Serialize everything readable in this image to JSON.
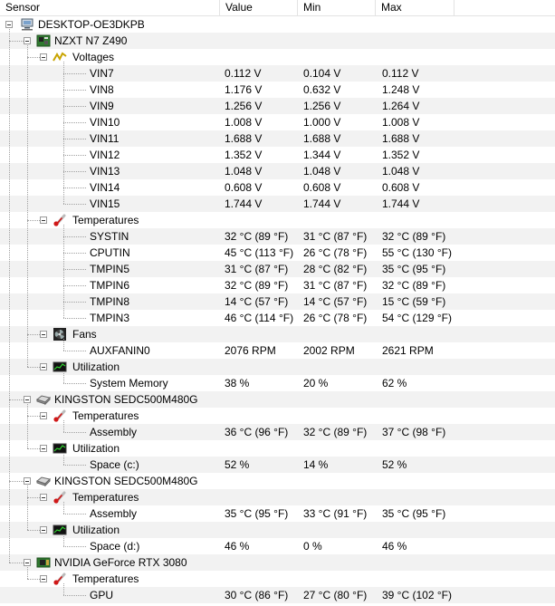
{
  "columns": {
    "sensor": "Sensor",
    "value": "Value",
    "min": "Min",
    "max": "Max"
  },
  "rows": [
    {
      "level": 0,
      "kind": "node",
      "icon": "computer-icon",
      "label": "DESKTOP-OE3DKPB"
    },
    {
      "level": 1,
      "kind": "node",
      "icon": "motherboard-icon",
      "label": "NZXT N7 Z490"
    },
    {
      "level": 2,
      "kind": "node",
      "icon": "voltage-icon",
      "label": "Voltages"
    },
    {
      "level": 3,
      "kind": "leaf",
      "label": "VIN7",
      "value": "0.112 V",
      "min": "0.104 V",
      "max": "0.112 V"
    },
    {
      "level": 3,
      "kind": "leaf",
      "label": "VIN8",
      "value": "1.176 V",
      "min": "0.632 V",
      "max": "1.248 V"
    },
    {
      "level": 3,
      "kind": "leaf",
      "label": "VIN9",
      "value": "1.256 V",
      "min": "1.256 V",
      "max": "1.264 V"
    },
    {
      "level": 3,
      "kind": "leaf",
      "label": "VIN10",
      "value": "1.008 V",
      "min": "1.000 V",
      "max": "1.008 V"
    },
    {
      "level": 3,
      "kind": "leaf",
      "label": "VIN11",
      "value": "1.688 V",
      "min": "1.688 V",
      "max": "1.688 V"
    },
    {
      "level": 3,
      "kind": "leaf",
      "label": "VIN12",
      "value": "1.352 V",
      "min": "1.344 V",
      "max": "1.352 V"
    },
    {
      "level": 3,
      "kind": "leaf",
      "label": "VIN13",
      "value": "1.048 V",
      "min": "1.048 V",
      "max": "1.048 V"
    },
    {
      "level": 3,
      "kind": "leaf",
      "label": "VIN14",
      "value": "0.608 V",
      "min": "0.608 V",
      "max": "0.608 V"
    },
    {
      "level": 3,
      "kind": "leaf",
      "label": "VIN15",
      "value": "1.744 V",
      "min": "1.744 V",
      "max": "1.744 V"
    },
    {
      "level": 2,
      "kind": "node",
      "icon": "thermometer-icon",
      "label": "Temperatures"
    },
    {
      "level": 3,
      "kind": "leaf",
      "label": "SYSTIN",
      "value": "32 °C  (89 °F)",
      "min": "31 °C  (87 °F)",
      "max": "32 °C  (89 °F)"
    },
    {
      "level": 3,
      "kind": "leaf",
      "label": "CPUTIN",
      "value": "45 °C  (113 °F)",
      "min": "26 °C  (78 °F)",
      "max": "55 °C  (130 °F)"
    },
    {
      "level": 3,
      "kind": "leaf",
      "label": "TMPIN5",
      "value": "31 °C  (87 °F)",
      "min": "28 °C  (82 °F)",
      "max": "35 °C  (95 °F)"
    },
    {
      "level": 3,
      "kind": "leaf",
      "label": "TMPIN6",
      "value": "32 °C  (89 °F)",
      "min": "31 °C  (87 °F)",
      "max": "32 °C  (89 °F)"
    },
    {
      "level": 3,
      "kind": "leaf",
      "label": "TMPIN8",
      "value": "14 °C  (57 °F)",
      "min": "14 °C  (57 °F)",
      "max": "15 °C  (59 °F)"
    },
    {
      "level": 3,
      "kind": "leaf",
      "label": "TMPIN3",
      "value": "46 °C  (114 °F)",
      "min": "26 °C  (78 °F)",
      "max": "54 °C  (129 °F)"
    },
    {
      "level": 2,
      "kind": "node",
      "icon": "fan-icon",
      "label": "Fans"
    },
    {
      "level": 3,
      "kind": "leaf",
      "label": "AUXFANIN0",
      "value": "2076 RPM",
      "min": "2002 RPM",
      "max": "2621 RPM"
    },
    {
      "level": 2,
      "kind": "node",
      "icon": "utilization-icon",
      "label": "Utilization"
    },
    {
      "level": 3,
      "kind": "leaf",
      "label": "System Memory",
      "value": "38 %",
      "min": "20 %",
      "max": "62 %"
    },
    {
      "level": 1,
      "kind": "node",
      "icon": "drive-icon",
      "label": "KINGSTON SEDC500M480G"
    },
    {
      "level": 2,
      "kind": "node",
      "icon": "thermometer-icon",
      "label": "Temperatures"
    },
    {
      "level": 3,
      "kind": "leaf",
      "label": "Assembly",
      "value": "36 °C  (96 °F)",
      "min": "32 °C  (89 °F)",
      "max": "37 °C  (98 °F)"
    },
    {
      "level": 2,
      "kind": "node",
      "icon": "utilization-icon",
      "label": "Utilization"
    },
    {
      "level": 3,
      "kind": "leaf",
      "label": "Space (c:)",
      "value": "52 %",
      "min": "14 %",
      "max": "52 %"
    },
    {
      "level": 1,
      "kind": "node",
      "icon": "drive-icon",
      "label": "KINGSTON SEDC500M480G"
    },
    {
      "level": 2,
      "kind": "node",
      "icon": "thermometer-icon",
      "label": "Temperatures"
    },
    {
      "level": 3,
      "kind": "leaf",
      "label": "Assembly",
      "value": "35 °C  (95 °F)",
      "min": "33 °C  (91 °F)",
      "max": "35 °C  (95 °F)"
    },
    {
      "level": 2,
      "kind": "node",
      "icon": "utilization-icon",
      "label": "Utilization"
    },
    {
      "level": 3,
      "kind": "leaf",
      "label": "Space (d:)",
      "value": "46 %",
      "min": "0 %",
      "max": "46 %"
    },
    {
      "level": 1,
      "kind": "node",
      "icon": "gpu-icon",
      "label": "NVIDIA GeForce RTX 3080"
    },
    {
      "level": 2,
      "kind": "node",
      "icon": "thermometer-icon",
      "label": "Temperatures"
    },
    {
      "level": 3,
      "kind": "leaf",
      "label": "GPU",
      "value": "30 °C  (86 °F)",
      "min": "27 °C  (80 °F)",
      "max": "39 °C  (102 °F)"
    }
  ]
}
